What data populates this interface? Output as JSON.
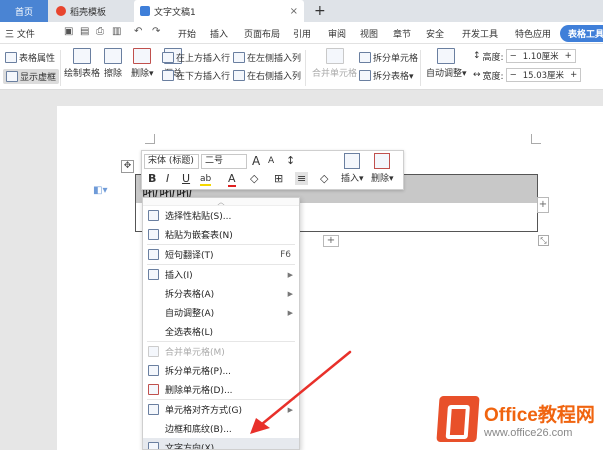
{
  "tabs": {
    "home": "首页",
    "template": "稻壳模板",
    "document": "文字文稿1",
    "close": "×",
    "add": "+"
  },
  "menubar": {
    "file": "三 文件",
    "items": [
      "开始",
      "插入",
      "页面布局",
      "引用",
      "审阅",
      "视图",
      "章节",
      "安全",
      "开发工具",
      "特色应用",
      "表格工具"
    ],
    "active": "表格工具"
  },
  "ribbon": {
    "table_properties": "表格属性",
    "show_gridlines": "显示虚框",
    "draw_table": "绘制表格",
    "erase": "擦除",
    "delete": "删除▾",
    "summary": "汇总",
    "insert_above": "在上方插入行",
    "insert_below": "在下方插入行",
    "insert_left": "在左侧插入列",
    "insert_right": "在右侧插入列",
    "merge_cells": "合并单元格",
    "split_cells": "拆分单元格",
    "split_table": "拆分表格▾",
    "auto_fit": "自动调整▾",
    "height_label": "高度:",
    "height_value": "1.10厘米",
    "width_label": "宽度:",
    "width_value": "15.03厘米",
    "minus": "−",
    "plus": "+"
  },
  "float_toolbar": {
    "font": "宋体 (标题)",
    "size": "二号",
    "grow": "A",
    "shrink": "A",
    "spacing": "↕",
    "bold": "B",
    "italic": "I",
    "underline": "U",
    "highlight": "ab",
    "fontcolor": "A",
    "shading": "◇",
    "border": "⊞",
    "align": "≡",
    "erase": "◇",
    "insert": "插入▾",
    "delete": "删除▾"
  },
  "table": {
    "cell_text": "啦啦啦",
    "add_column": "+",
    "add_row": "+",
    "move_handle": "✥",
    "resize_handle": "⤡"
  },
  "context_menu": {
    "collapse": "︿",
    "items": [
      {
        "label": "选择性粘贴(S)...",
        "shortcut": "",
        "submenu": false,
        "disabled": false
      },
      {
        "label": "粘贴为嵌套表(N)",
        "shortcut": "",
        "submenu": false,
        "disabled": false
      },
      {
        "label": "短句翻译(T)",
        "shortcut": "F6",
        "submenu": false,
        "disabled": false
      },
      {
        "label": "插入(I)",
        "shortcut": "",
        "submenu": true,
        "disabled": false
      },
      {
        "label": "拆分表格(A)",
        "shortcut": "",
        "submenu": true,
        "disabled": false
      },
      {
        "label": "自动调整(A)",
        "shortcut": "",
        "submenu": true,
        "disabled": false
      },
      {
        "label": "全选表格(L)",
        "shortcut": "",
        "submenu": false,
        "disabled": false
      },
      {
        "label": "合并单元格(M)",
        "shortcut": "",
        "submenu": false,
        "disabled": true
      },
      {
        "label": "拆分单元格(P)...",
        "shortcut": "",
        "submenu": false,
        "disabled": false
      },
      {
        "label": "删除单元格(D)...",
        "shortcut": "",
        "submenu": false,
        "disabled": false
      },
      {
        "label": "单元格对齐方式(G)",
        "shortcut": "",
        "submenu": true,
        "disabled": false
      },
      {
        "label": "边框和底纹(B)...",
        "shortcut": "",
        "submenu": false,
        "disabled": false
      },
      {
        "label": "文字方向(X)...",
        "shortcut": "",
        "submenu": false,
        "disabled": false
      }
    ]
  },
  "watermark": {
    "title": "Office教程网",
    "url": "www.office26.com"
  },
  "colors": {
    "accent": "#3f7fd9",
    "arrow": "#e8302a",
    "logo": "#e8502a"
  }
}
